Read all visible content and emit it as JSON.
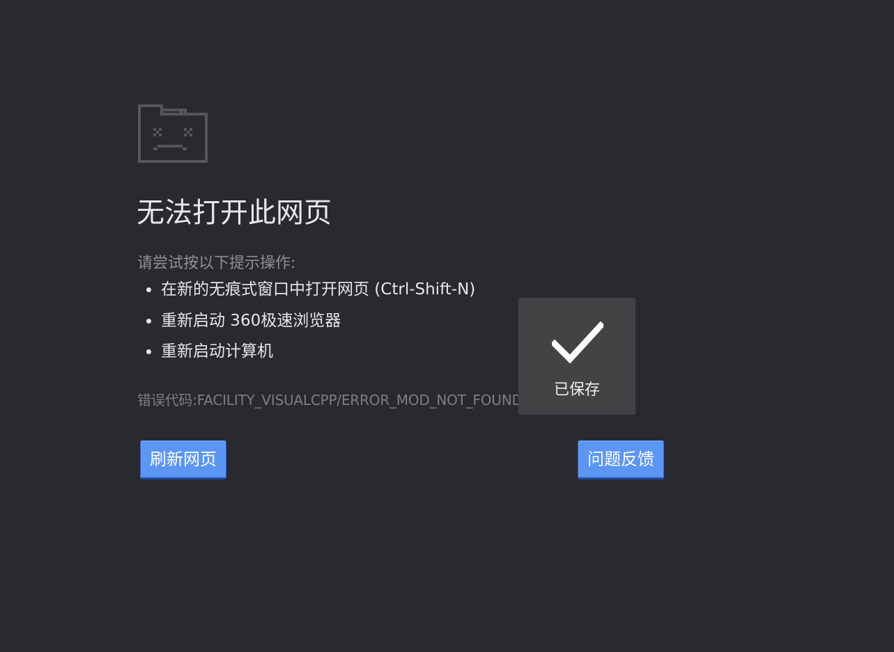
{
  "error_page": {
    "title": "无法打开此网页",
    "suggestion_heading": "请尝试按以下提示操作:",
    "suggestions": [
      "在新的无痕式窗口中打开网页 (Ctrl-Shift-N)",
      "重新启动 360极速浏览器",
      "重新启动计算机"
    ],
    "error_code_label": "错误代码:",
    "error_code": "FACILITY_VISUALCPP/ERROR_MOD_NOT_FOUND",
    "buttons": {
      "refresh_label": "刷新网页",
      "feedback_label": "问题反馈"
    }
  },
  "toast": {
    "icon": "checkmark-icon",
    "label": "已保存"
  },
  "icons": {
    "error": "sad-folder-icon"
  },
  "colors": {
    "background": "#282a2f",
    "button": "#5b96f2",
    "toast": "#444546"
  }
}
